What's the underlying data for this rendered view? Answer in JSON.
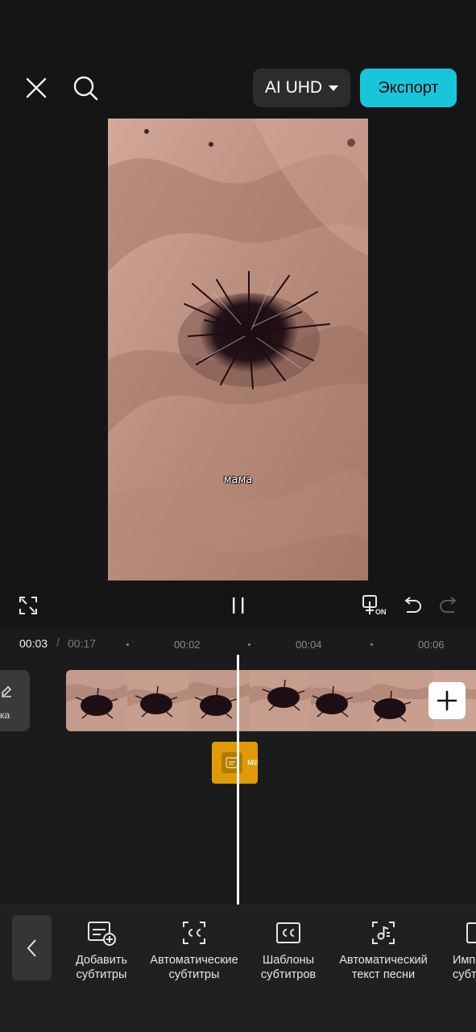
{
  "header": {
    "close_icon": "close-icon",
    "search_icon": "search-icon",
    "quality_label": "AI UHD",
    "export_label": "Экспорт"
  },
  "preview": {
    "caption_text": "мама"
  },
  "controls": {
    "fullscreen_icon": "fullscreen-icon",
    "pause_icon": "pause-icon",
    "keyframe_toggle_badge": "ON",
    "undo_icon": "undo-icon",
    "redo_icon": "redo-icon"
  },
  "timeline": {
    "current_time": "00:03",
    "separator": "/",
    "total_time": "00:17",
    "ticks": [
      "00:02",
      "00:04",
      "00:06"
    ],
    "cover_label": "жка",
    "subtitle_clip_text": "ма",
    "add_clip_icon": "plus-icon"
  },
  "toolbar": {
    "back_icon": "chevron-left-icon",
    "items": [
      {
        "label": "Добавить\nсубтитры",
        "icon": "add-subtitles-icon"
      },
      {
        "label": "Автоматические\nсубтитры",
        "icon": "auto-captions-icon"
      },
      {
        "label": "Шаблоны\nсубтитров",
        "icon": "caption-templates-icon"
      },
      {
        "label": "Автоматический\nтекст песни",
        "icon": "auto-lyrics-icon"
      },
      {
        "label": "Имп\nсубти",
        "icon": "import-subtitles-icon"
      }
    ]
  },
  "colors": {
    "accent": "#18c6dc",
    "subtitle_clip": "#e09a08",
    "background": "#151515"
  }
}
